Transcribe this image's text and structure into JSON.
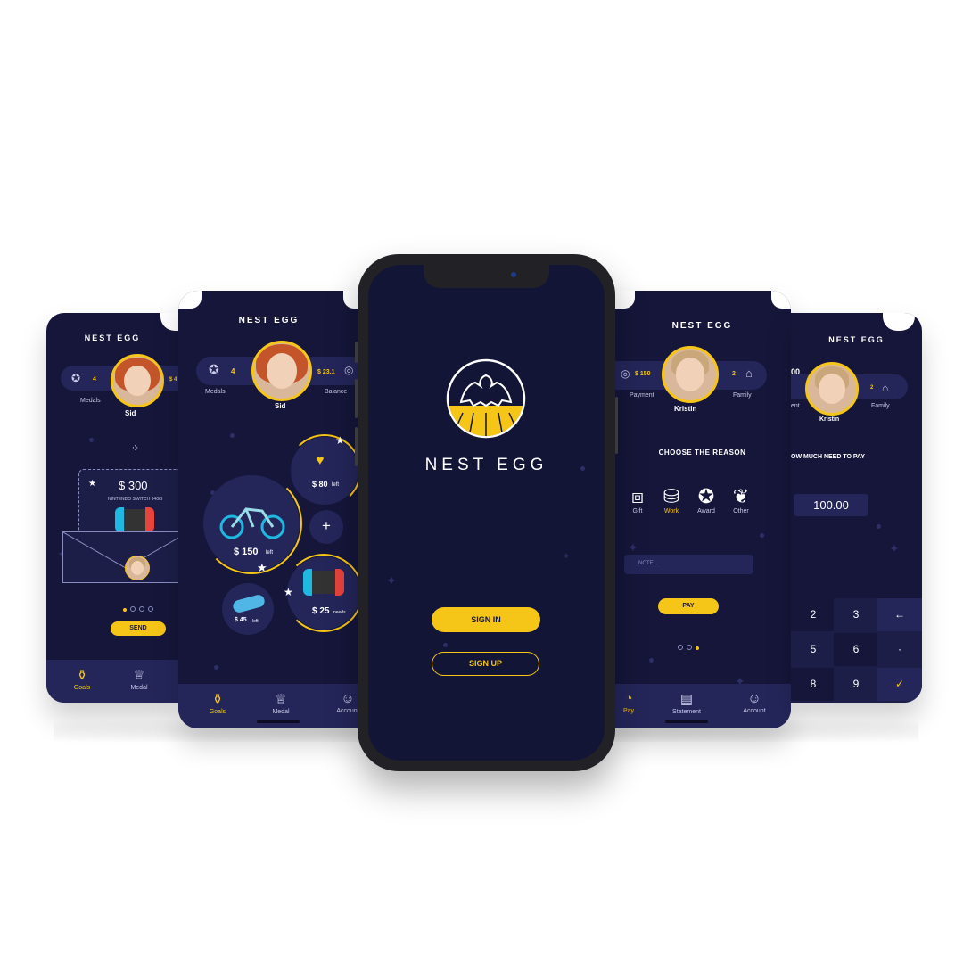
{
  "brand": {
    "name": "NEST EGG"
  },
  "colors": {
    "background": "#15163a",
    "accent": "#f5c518",
    "panel": "#24265a"
  },
  "screen1": {
    "title": "NEST EGG",
    "medals_value": "4",
    "medals_label": "Medals",
    "balance_partial": "$ 4",
    "child_name": "Sid",
    "gift_amount": "$ 300",
    "gift_item": "NINTENDO SWITCH 64GB",
    "send_label": "SEND",
    "nav": [
      {
        "label": "Goals",
        "icon": "goals-icon"
      },
      {
        "label": "Medal",
        "icon": "trophy-icon"
      }
    ]
  },
  "screen2": {
    "title": "NEST EGG",
    "medals_value": "4",
    "medals_label": "Medals",
    "balance_value": "$ 23.1",
    "balance_label": "Balance",
    "child_name": "Sid",
    "goals": [
      {
        "amount": "$ 150",
        "suffix": "left",
        "icon": "bicycle-icon"
      },
      {
        "amount": "$ 80",
        "suffix": "left",
        "icon": "heart-hand-icon"
      },
      {
        "amount": "$ 45",
        "suffix": "left",
        "icon": "toy-car-icon"
      },
      {
        "amount": "$ 25",
        "suffix": "needs",
        "icon": "game-console-icon"
      }
    ],
    "add_label": "+",
    "nav": [
      {
        "label": "Goals",
        "icon": "goals-icon"
      },
      {
        "label": "Medal",
        "icon": "trophy-icon"
      },
      {
        "label": "Account",
        "icon": "account-icon"
      }
    ]
  },
  "screen3": {
    "brand": "NEST EGG",
    "sign_in": "SIGN IN",
    "sign_up": "SIGN UP"
  },
  "screen4": {
    "title": "NEST EGG",
    "payment_value": "$ 150",
    "payment_label": "Payment",
    "family_value": "2",
    "family_label": "Family",
    "parent_name": "Kristin",
    "heading": "CHOOSE THE REASON",
    "reasons": [
      {
        "label": "Gift",
        "icon": "gift-icon"
      },
      {
        "label": "Work",
        "icon": "work-bucket-icon"
      },
      {
        "label": "Award",
        "icon": "award-icon"
      },
      {
        "label": "Other",
        "icon": "other-icon"
      }
    ],
    "note_placeholder": "NOTE...",
    "pay_label": "PAY",
    "nav": [
      {
        "label": "Pay",
        "icon": "pay-icon"
      },
      {
        "label": "Statement",
        "icon": "statement-icon"
      },
      {
        "label": "Account",
        "icon": "account-icon"
      }
    ]
  },
  "screen5": {
    "title": "NEST EGG",
    "payment_partial": "00",
    "payment_label_partial": "ent",
    "family_value": "2",
    "family_label": "Family",
    "parent_name": "Kristin",
    "heading": "OW MUCH NEED TO PAY",
    "amount": "100.00",
    "keys": [
      "2",
      "3",
      "←",
      "5",
      "6",
      "·",
      "8",
      "9",
      "✓"
    ]
  }
}
